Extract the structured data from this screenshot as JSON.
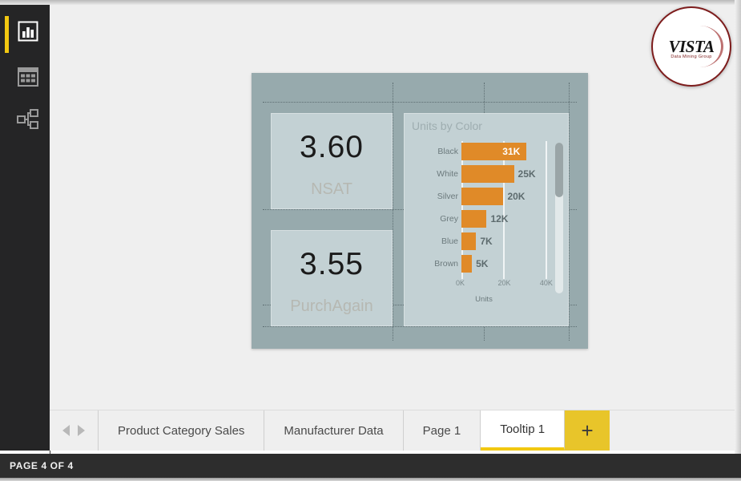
{
  "app": {
    "status_text": "PAGE 4 OF 4"
  },
  "logo": {
    "name": "VISTA",
    "tagline": "Data Mining Group"
  },
  "sidebar": {
    "items": [
      {
        "name": "report-view",
        "icon": "bar-chart-icon"
      },
      {
        "name": "data-view",
        "icon": "table-grid-icon"
      },
      {
        "name": "model-view",
        "icon": "relationships-icon"
      }
    ]
  },
  "report": {
    "cards": [
      {
        "value": "3.60",
        "label": "NSAT"
      },
      {
        "value": "3.55",
        "label": "PurchAgain"
      }
    ]
  },
  "chart_data": {
    "type": "bar",
    "orientation": "horizontal",
    "title": "Units by Color",
    "xlabel": "Units",
    "ylabel": "",
    "categories": [
      "Black",
      "White",
      "Silver",
      "Grey",
      "Blue",
      "Brown"
    ],
    "values": [
      31000,
      25000,
      20000,
      12000,
      7000,
      5000
    ],
    "value_labels": [
      "31K",
      "25K",
      "20K",
      "12K",
      "7K",
      "5K"
    ],
    "label_placement": [
      "inside",
      "outside",
      "outside",
      "outside",
      "outside",
      "outside"
    ],
    "xlim": [
      0,
      45000
    ],
    "xticks": [
      0,
      20000,
      40000
    ],
    "xtick_labels": [
      "0K",
      "20K",
      "40K"
    ],
    "grid": true,
    "legend": false,
    "bar_color": "#e08a28",
    "highlight_color": "#ffffff",
    "plot_background": "#c3d1d4"
  },
  "tabs": {
    "nav": {
      "prev": "◀",
      "next": "▶"
    },
    "items": [
      {
        "label": "Product Category Sales",
        "active": false
      },
      {
        "label": "Manufacturer Data",
        "active": false
      },
      {
        "label": "Page 1",
        "active": false
      },
      {
        "label": "Tooltip 1",
        "active": true
      }
    ],
    "add_label": "+"
  },
  "colors": {
    "accent_yellow": "#f2c811",
    "canvas_slate": "#97aaad",
    "visual_panel": "#c3d1d4",
    "bar_orange": "#e08a28",
    "rail_dark": "#252526"
  }
}
